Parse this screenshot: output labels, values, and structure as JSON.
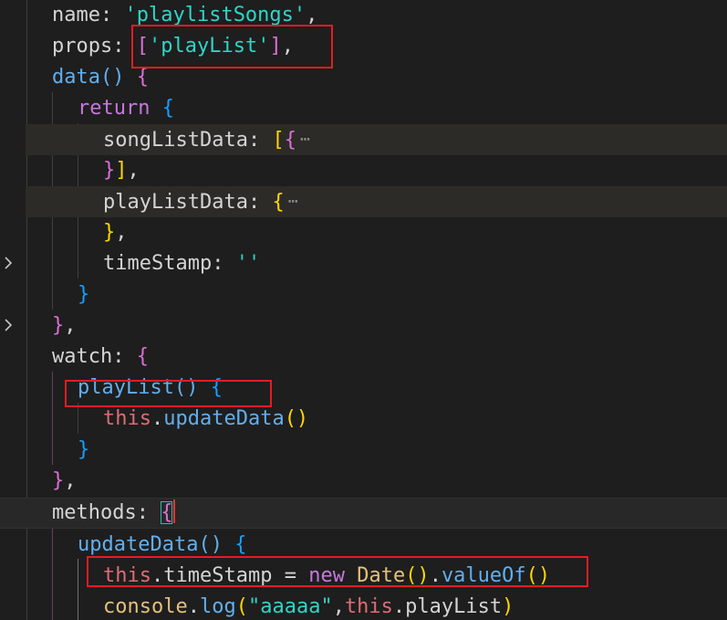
{
  "editor": {
    "lines": {
      "l1": {
        "key": "name",
        "colon": ": ",
        "value": "'playlistSongs'",
        "trail": ","
      },
      "l2": {
        "key": "props",
        "colon": ": ",
        "open": "[",
        "value": "'playList'",
        "close": "]",
        "trail": ","
      },
      "l3": {
        "fn": "data",
        "parens": "()",
        "sp": " ",
        "brace": "{"
      },
      "l4": {
        "kw": "return",
        "sp": " ",
        "brace": "{"
      },
      "l5": {
        "key": "songListData",
        "colon": ": ",
        "open": "[",
        "brace": "{",
        "ellipsis": "⋯"
      },
      "l6": {
        "brace": "}",
        "close": "]",
        "trail": ","
      },
      "l7": {
        "key": "playListData",
        "colon": ": ",
        "brace": "{",
        "ellipsis": "⋯"
      },
      "l8": {
        "brace": "}",
        "trail": ","
      },
      "l9": {
        "key": "timeStamp",
        "colon": ": ",
        "value": "''"
      },
      "l10": {
        "brace": "}"
      },
      "l11": {
        "brace": "}",
        "trail": ","
      },
      "l12": {
        "key": "watch",
        "colon": ": ",
        "brace": "{"
      },
      "l13": {
        "fn": "playList",
        "parens": "()",
        "sp": " ",
        "brace": "{"
      },
      "l14": {
        "this": "this",
        "dot": ".",
        "fn": "updateData",
        "parens": "()"
      },
      "l15": {
        "brace": "}"
      },
      "l16": {
        "brace": "}",
        "trail": ","
      },
      "l17": {
        "key": "methods",
        "colon": ": ",
        "brace": "{"
      },
      "l18": {
        "fn": "updateData",
        "parens": "()",
        "sp": " ",
        "brace": "{"
      },
      "l19": {
        "this": "this",
        "dot": ".",
        "prop": "timeStamp",
        "op": " = ",
        "kw": "new",
        "sp": " ",
        "cls": "Date",
        "parens": "()",
        "dot2": ".",
        "fn": "valueOf",
        "parens2": "()"
      },
      "l20": {
        "obj": "console",
        "dot": ".",
        "fn": "log",
        "open": "(",
        "value": "\"aaaaa\"",
        "comma": ",",
        "this": "this",
        "dot2": ".",
        "prop": "playList",
        "close": ")"
      }
    }
  },
  "icons": {
    "fold_chevron": "chevron-right-icon"
  },
  "colors": {
    "background": "#1e1e1e",
    "string": "#2ed6c7",
    "keyword": "#c678dd",
    "function": "#61afef",
    "this": "#e06c75",
    "class": "#e5c07b",
    "bracket_gold": "#ffd700",
    "bracket_orchid": "#da70d6",
    "bracket_blue": "#179fff",
    "annotation_box": "#e51c23"
  }
}
